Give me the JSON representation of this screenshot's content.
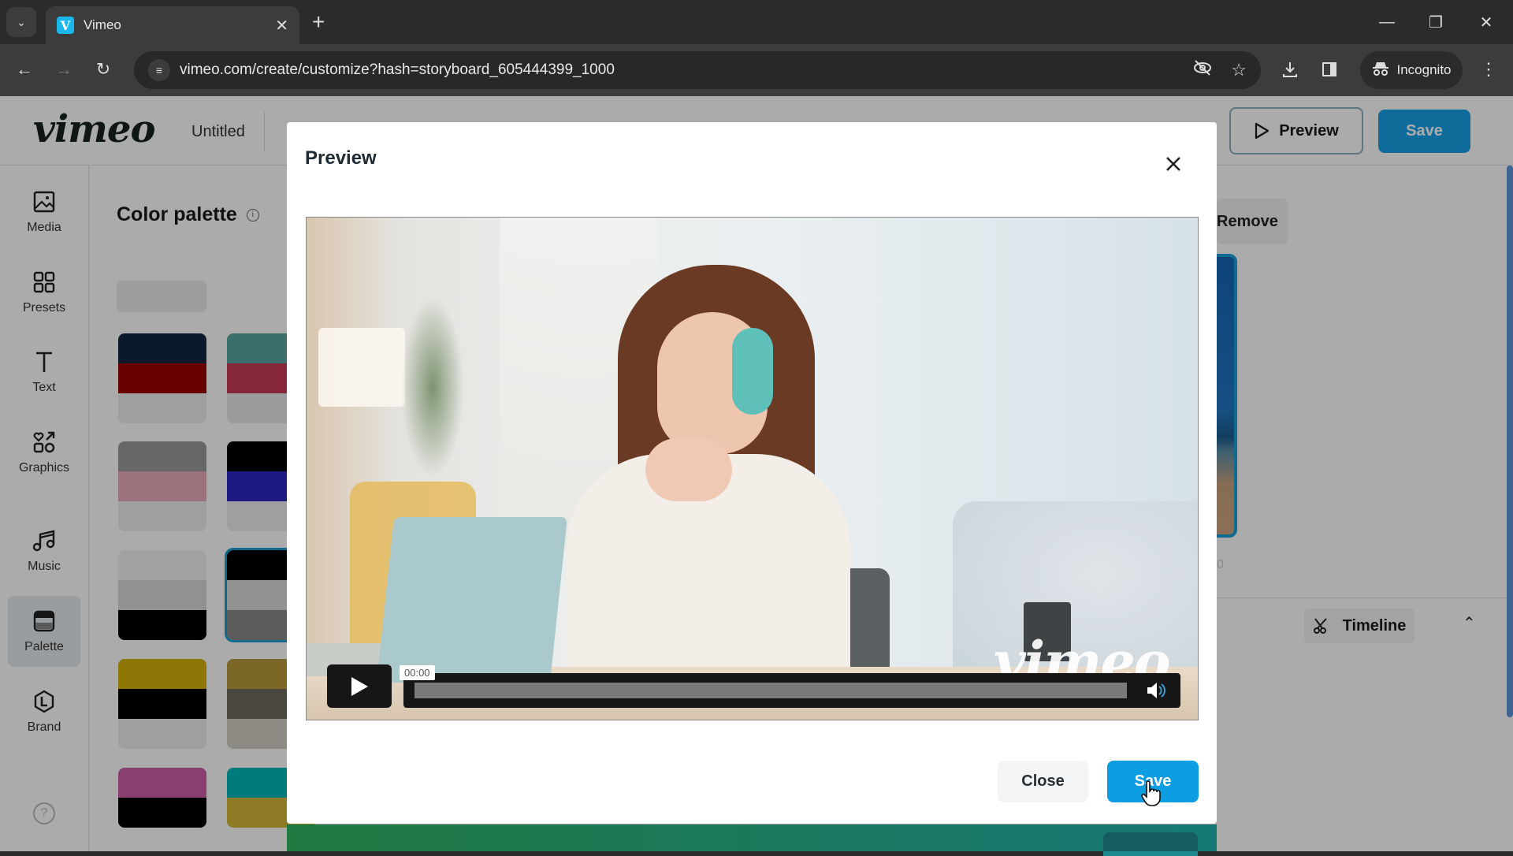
{
  "browser": {
    "tab_title": "Vimeo",
    "tab_favicon": "V",
    "url": "vimeo.com/create/customize?hash=storyboard_605444399_1000",
    "incognito_label": "Incognito",
    "icons": [
      "tab-search-icon",
      "close-tab-icon",
      "new-tab-icon",
      "minimize-icon",
      "restore-icon",
      "close-window-icon",
      "back-icon",
      "forward-icon",
      "reload-icon",
      "site-settings-icon",
      "eye-off-icon",
      "star-icon",
      "download-icon",
      "side-panel-icon",
      "incognito-icon",
      "more-menu-icon"
    ]
  },
  "app": {
    "logo": "vimeo",
    "project_title": "Untitled",
    "header": {
      "preview_label": "Preview",
      "save_label": "Save"
    },
    "sidebar": {
      "items": [
        {
          "label": "Media",
          "icon": "image-icon",
          "active": false
        },
        {
          "label": "Presets",
          "icon": "grid-icon",
          "active": false
        },
        {
          "label": "Text",
          "icon": "text-icon",
          "active": false
        },
        {
          "label": "Graphics",
          "icon": "graphics-icon",
          "active": false
        },
        {
          "label": "Music",
          "icon": "music-icon",
          "active": false
        },
        {
          "label": "Palette",
          "icon": "palette-icon",
          "active": true
        },
        {
          "label": "Brand",
          "icon": "brand-icon",
          "active": false
        }
      ],
      "help_icon": "?"
    },
    "palette_panel": {
      "title": "Color palette",
      "info_icon": "i",
      "palettes": [
        {
          "colors": [
            "#0f2742",
            "#9b0000",
            "#eeeeee"
          ],
          "selected": false
        },
        {
          "colors": [
            "#57a6a1",
            "#c83a55",
            "#e8e8e8"
          ],
          "selected": false
        },
        {
          "colors": [
            "#9a9a9a",
            "#e8aab8",
            "#eeeeee"
          ],
          "selected": false
        },
        {
          "colors": [
            "#000000",
            "#2b28c2",
            "#eeeeee"
          ],
          "selected": false
        },
        {
          "colors": [
            "#f2f2f2",
            "#d8d8d8",
            "#000000"
          ],
          "selected": false
        },
        {
          "colors": [
            "#000000",
            "#dcdcdc",
            "#8a8a8a"
          ],
          "selected": true
        },
        {
          "colors": [
            "#d4b20a",
            "#000000",
            "#eeeeee"
          ],
          "selected": false
        },
        {
          "colors": [
            "#b89a3c",
            "#6f6a5e",
            "#d4d0c6"
          ],
          "selected": false
        },
        {
          "colors": [
            "#cc5fa6",
            "#000000"
          ],
          "selected": false
        },
        {
          "colors": [
            "#00b8b8",
            "#d2b83a"
          ],
          "selected": false
        }
      ]
    },
    "right_panel": {
      "remove_label": "Remove",
      "thumb_time": "0",
      "timeline_label": "Timeline"
    }
  },
  "modal": {
    "title": "Preview",
    "video": {
      "current_time": "00:00",
      "progress": 0,
      "watermark": "vimeo",
      "description": "Woman wearing teal headphones at a laptop in a bright home office"
    },
    "close_label": "Close",
    "save_label": "Save"
  },
  "colors": {
    "accent": "#17a2e6",
    "selected_outline": "#1a9fd4"
  }
}
